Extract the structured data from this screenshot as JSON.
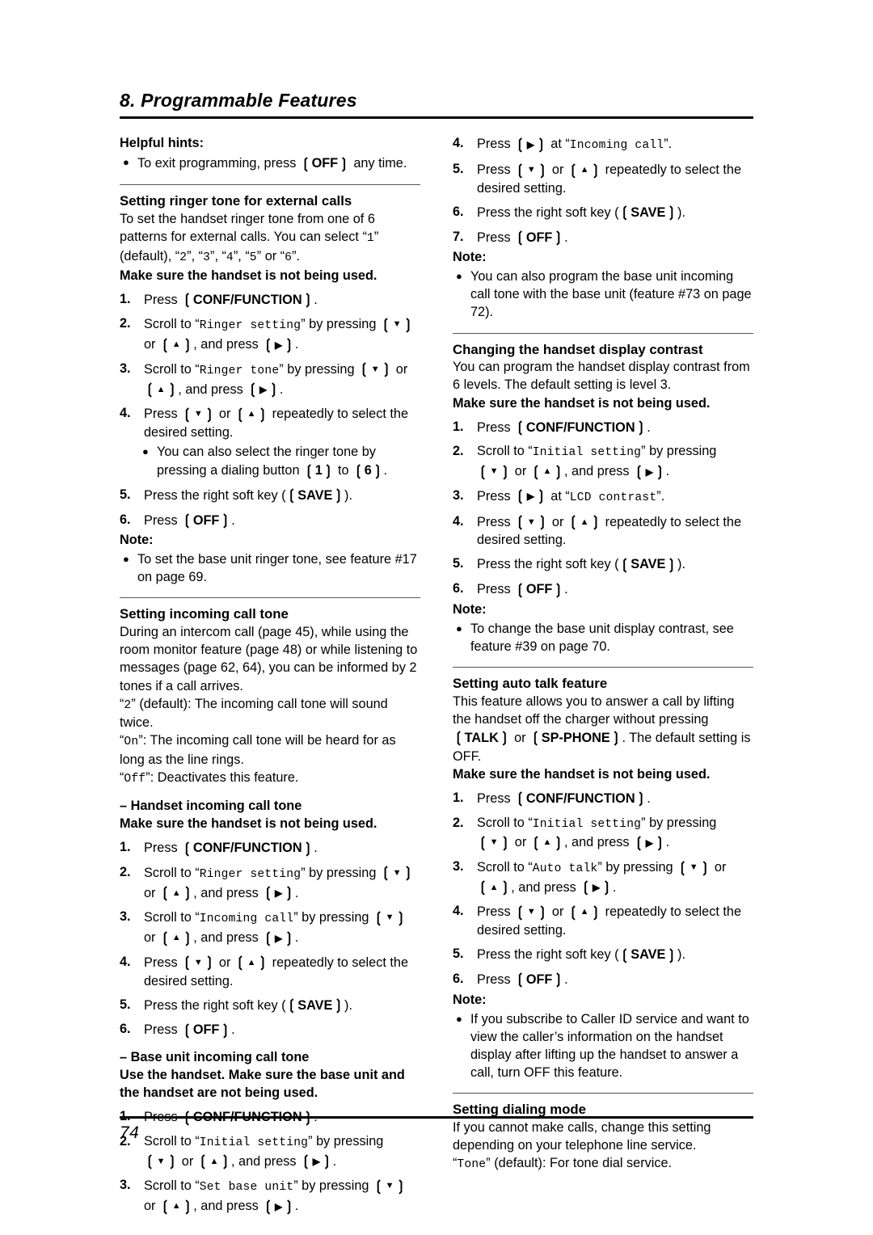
{
  "header": {
    "chapter": "8. Programmable Features"
  },
  "footer": {
    "page_number": "74"
  },
  "glyphs": {
    "bracket_open": "❲",
    "bracket_close": "❳",
    "arrow_down": "▼",
    "arrow_up": "▲",
    "arrow_right": "▶",
    "bullet": "●",
    "dash": "–"
  },
  "keys": {
    "off": "OFF",
    "conf_function": "CONF/FUNCTION",
    "save": "SAVE",
    "talk": "TALK",
    "sp_phone": "SP-PHONE",
    "digit_1": "1",
    "digit_6": "6"
  },
  "left_column": {
    "helpful_hints": {
      "title": "Helpful hints:",
      "bullet_pre": "To exit programming, press ",
      "bullet_post": " any time."
    },
    "ringer_tone": {
      "title": "Setting ringer tone for external calls",
      "intro": "To set the handset ringer tone from one of 6 patterns for external calls. You can select “1” (default), “2”, “3”, “4”, “5” or “6”.",
      "intro_plain_1": "To set the handset ringer tone from one of 6 patterns for external calls. You can select “",
      "opt_1": "1",
      "intro_plain_2": "” (default), “",
      "opt_2": "2",
      "sep": "”, “",
      "opt_3": "3",
      "opt_4": "4",
      "opt_5": "5",
      "intro_plain_3": "” or “",
      "opt_6": "6",
      "intro_plain_4": "”.",
      "precondition": "Make sure the handset is not being used.",
      "step1_pre": "Press ",
      "step1_post": ".",
      "step2_pre": "Scroll to “",
      "step2_lcd": "Ringer setting",
      "step2_mid": "” by pressing ",
      "step2_or": " or ",
      "step2_and": ", and press ",
      "step2_post": ".",
      "step3_lcd": "Ringer tone",
      "step4_pre": "Press ",
      "step4_mid": " repeatedly to select the desired setting.",
      "step4_bullet_pre": "You can also select the ringer tone by pressing a dialing button ",
      "step4_bullet_mid": " to ",
      "step4_bullet_post": ".",
      "step5_pre": "Press the right soft key (",
      "step5_post": ").",
      "step6_pre": "Press ",
      "note_title": "Note:",
      "note_bullet": "To set the base unit ringer tone, see feature #17 on page 69."
    },
    "incoming_call_tone": {
      "title": "Setting incoming call tone",
      "intro": "During an intercom call (page 45), while using the room monitor feature (page 48) or while listening to messages (page 62, 64), you can be informed by 2 tones if a call arrives.",
      "opt_2": "2",
      "opt_2_desc": "” (default): The incoming call tone will sound twice.",
      "opt_on": "On",
      "opt_on_desc": "”: The incoming call tone will be heard for as long as the line rings.",
      "opt_off": "Off",
      "opt_off_desc": "”: Deactivates this feature.",
      "handset_heading": "Handset incoming call tone",
      "handset_precondition": "Make sure the handset is not being used.",
      "handset_step2_lcd": "Ringer setting",
      "handset_step3_lcd": "Incoming call",
      "base_heading": "Base unit incoming call tone",
      "base_precondition": "Use the handset. Make sure the base unit and the handset are not being used.",
      "base_step2_lcd": "Initial setting",
      "base_step3_lcd": "Set base unit"
    }
  },
  "right_column": {
    "base_continued": {
      "step4_pre": "Press ",
      "step4_mid": " at “",
      "step4_lcd": "Incoming call",
      "step4_post": "”.",
      "step5_mid": " repeatedly to select the desired setting.",
      "step6_pre": "Press the right soft key (",
      "step6_post": ").",
      "step7_pre": "Press ",
      "note_title": "Note:",
      "note_bullet": "You can also program the base unit incoming call tone with the base unit (feature #73 on page 72)."
    },
    "display_contrast": {
      "title": "Changing the handset display contrast",
      "intro": "You can program the handset display contrast from 6 levels. The default setting is level 3.",
      "precondition": "Make sure the handset is not being used.",
      "step2_lcd": "Initial setting",
      "step3_pre": "Press ",
      "step3_mid": " at “",
      "step3_lcd": "LCD contrast",
      "step3_post": "”.",
      "note_title": "Note:",
      "note_bullet": "To change the base unit display contrast, see feature #39 on page 70."
    },
    "auto_talk": {
      "title": "Setting auto talk feature",
      "intro_1": "This feature allows you to answer a call by lifting the handset off the charger without pressing ",
      "intro_or": " or ",
      "intro_2": ". The default setting is OFF.",
      "precondition": "Make sure the handset is not being used.",
      "step2_lcd": "Initial setting",
      "step3_lcd": "Auto talk",
      "note_title": "Note:",
      "note_bullet": "If you subscribe to Caller ID service and want to view the caller’s information on the handset display after lifting up the handset to answer a call, turn OFF this feature."
    },
    "dialing_mode": {
      "title": "Setting dialing mode",
      "intro": "If you cannot make calls, change this setting depending on your telephone line service.",
      "opt_tone": "Tone",
      "opt_tone_desc": "” (default): For tone dial service."
    }
  },
  "common": {
    "press": "Press ",
    "scroll_to": "Scroll to “",
    "by_pressing": "” by pressing ",
    "or": " or ",
    "and_press": ", and press ",
    "period": ".",
    "repeatedly": " repeatedly to select the desired setting.",
    "right_soft_key_pre": "Press the right soft key (",
    "right_soft_key_post": ").",
    "precondition": "Make sure the handset is not being used.",
    "note_title": "Note:",
    "step_numbers": [
      "1.",
      "2.",
      "3.",
      "4.",
      "5.",
      "6.",
      "7."
    ]
  }
}
